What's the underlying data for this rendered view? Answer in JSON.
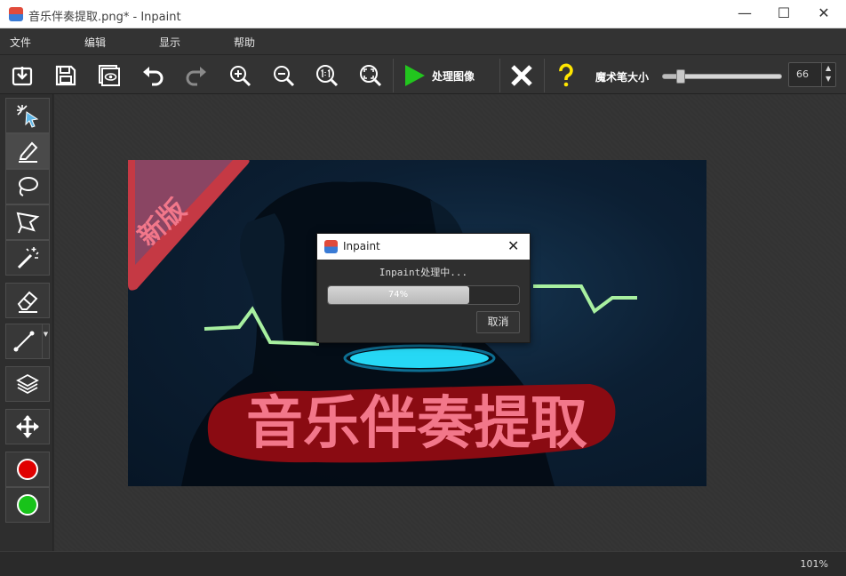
{
  "window": {
    "title": "音乐伴奏提取.png* - Inpaint",
    "minimize": "—",
    "maximize": "☐",
    "close": "✕"
  },
  "menu": {
    "items": [
      "文件",
      "编辑",
      "显示",
      "帮助"
    ]
  },
  "toolbar": {
    "process_label": "处理图像",
    "brush_size_label": "魔术笔大小",
    "brush_size_value": "66",
    "brush_size_level": 0.15,
    "icons": [
      "open-icon",
      "save-icon",
      "preview-icon",
      "undo-icon",
      "redo-icon",
      "zoom-in-icon",
      "zoom-out-icon",
      "actual-size-icon",
      "fit-icon",
      "play-icon",
      "cancel-x-icon",
      "help-icon"
    ]
  },
  "tools": {
    "icons": [
      "magic-wand-select-icon",
      "marker-icon",
      "lasso-icon",
      "polygon-lasso-icon",
      "magic-wand-icon",
      "eraser-icon",
      "line-icon",
      "layers-icon",
      "move-icon"
    ],
    "colors": {
      "red": "#e00000",
      "green": "#18c31a"
    }
  },
  "image": {
    "banner_text": "新版",
    "main_text": "音乐伴奏提取"
  },
  "dialog": {
    "title": "Inpaint",
    "close": "✕",
    "message": "Inpaint处理中...",
    "progress_text": "74%",
    "progress_level": 0.74,
    "cancel_label": "取消"
  },
  "status": {
    "zoom": "101%"
  },
  "colors": {
    "accent_green": "#22c51e",
    "help_yellow": "#ffe600",
    "banner_red": "#d9353f",
    "text_pink": "#f2778a",
    "neon": "#a8f0a0",
    "cyan": "#26d8f5"
  }
}
